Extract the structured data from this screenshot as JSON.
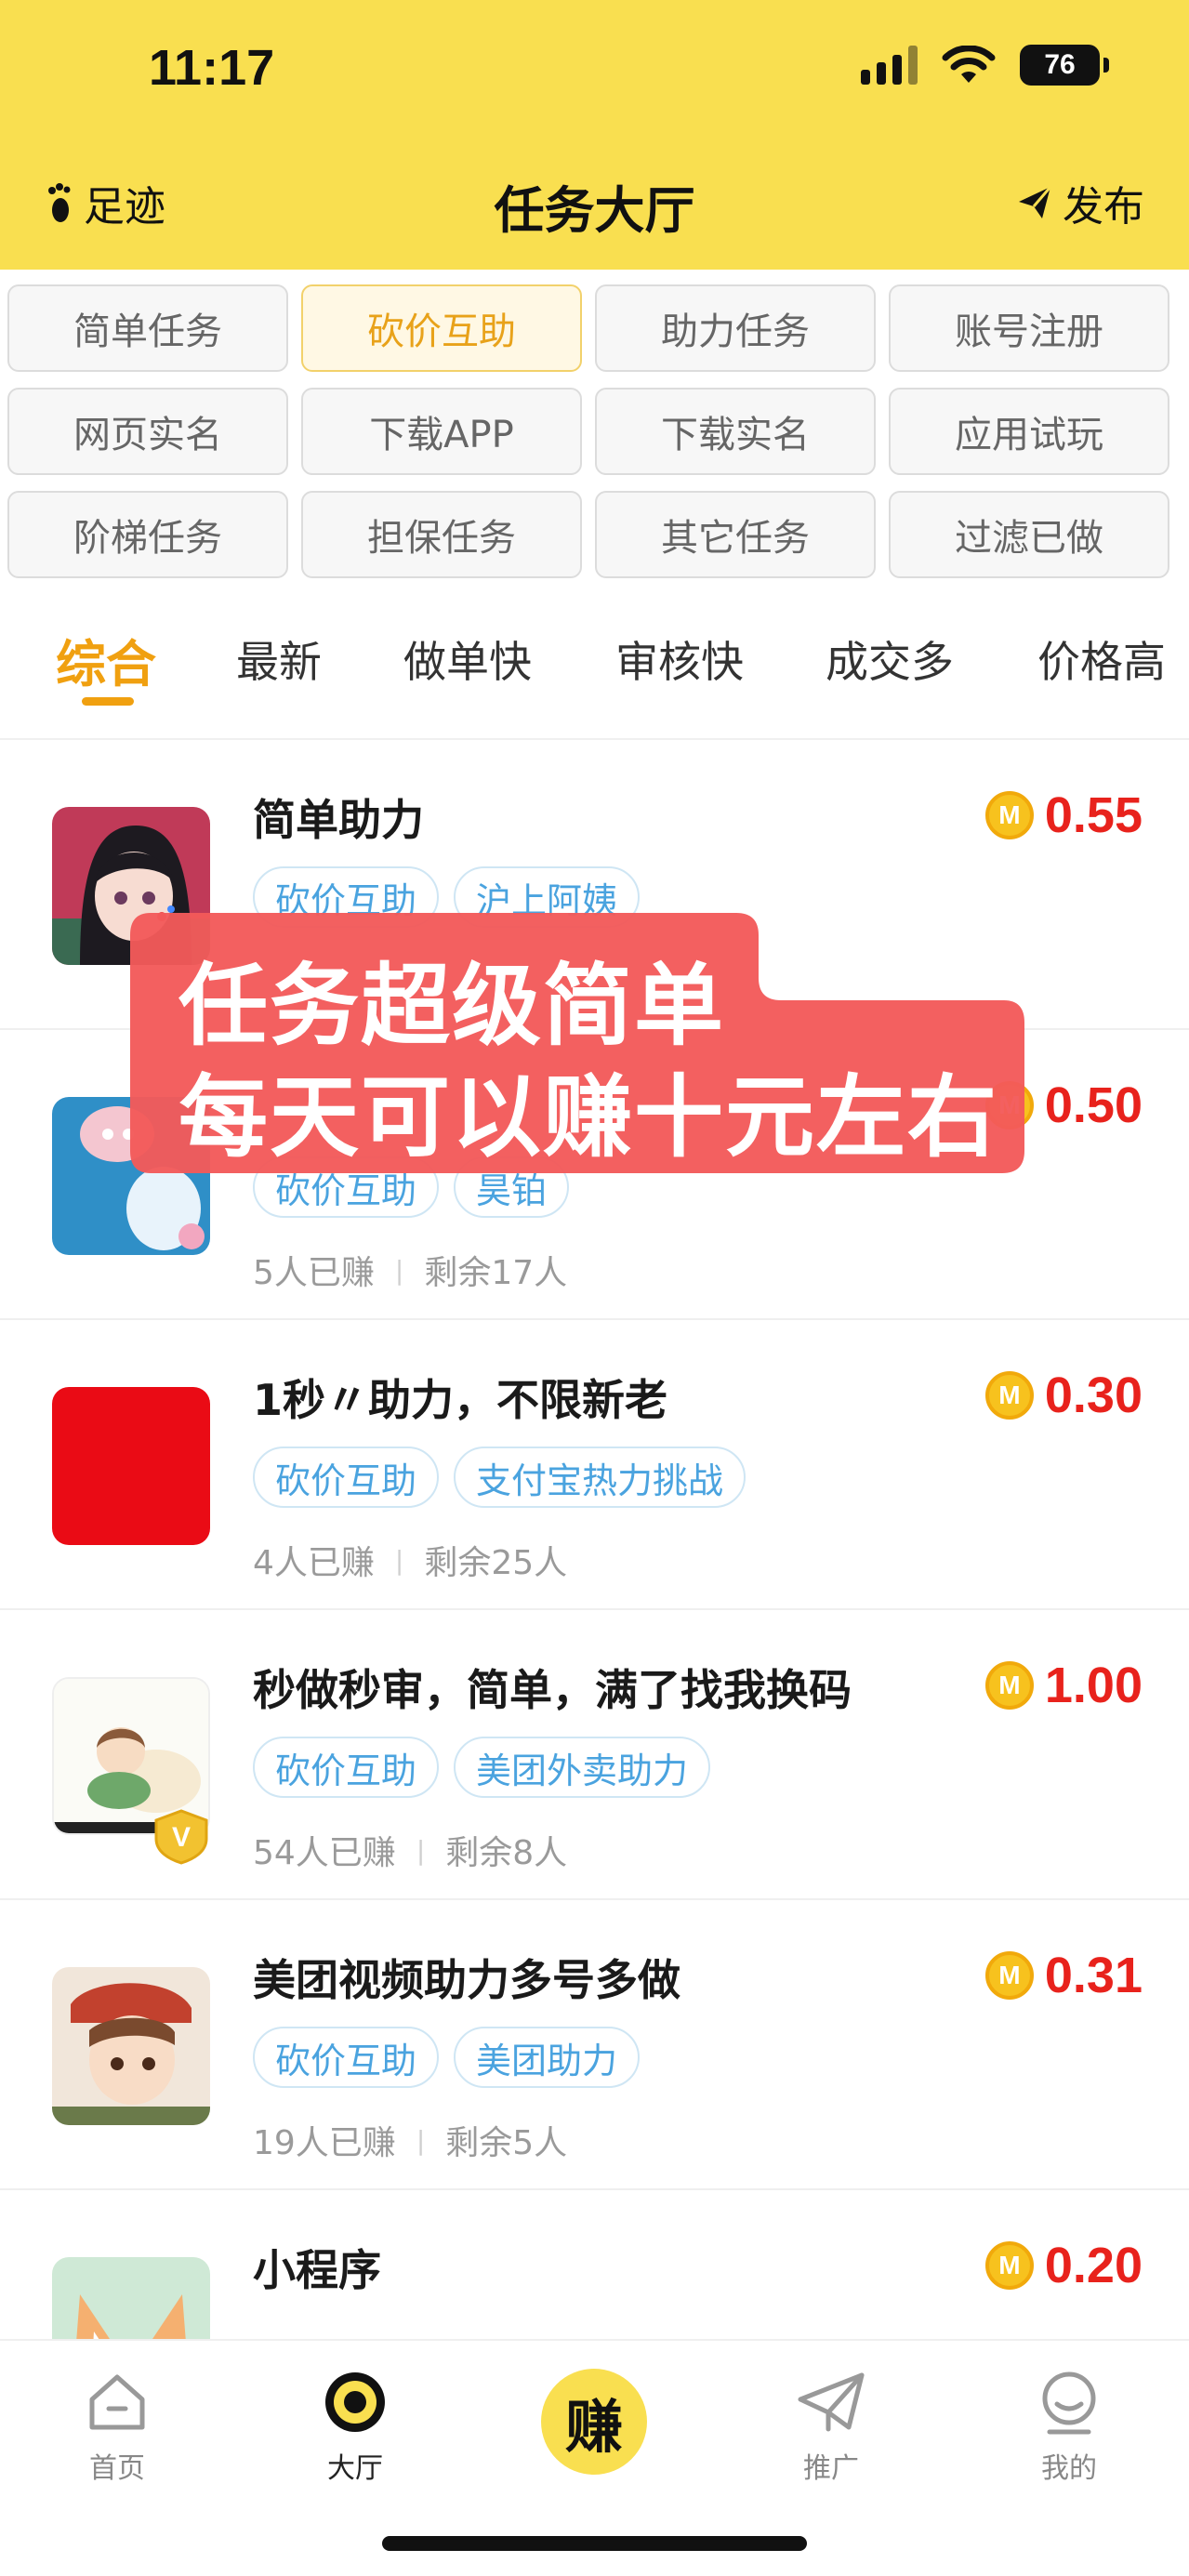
{
  "status_bar": {
    "time": "11:17",
    "battery": "76"
  },
  "nav": {
    "left_label": "足迹",
    "title": "任务大厅",
    "right_label": "发布"
  },
  "categories": [
    {
      "label": "简单任务"
    },
    {
      "label": "砍价互助"
    },
    {
      "label": "助力任务"
    },
    {
      "label": "账号注册"
    },
    {
      "label": "网页实名"
    },
    {
      "label": "下载APP"
    },
    {
      "label": "下载实名"
    },
    {
      "label": "应用试玩"
    },
    {
      "label": "阶梯任务"
    },
    {
      "label": "担保任务"
    },
    {
      "label": "其它任务"
    },
    {
      "label": "过滤已做"
    }
  ],
  "selected_category": "砍价互助",
  "sort_tabs": [
    {
      "label": "综合"
    },
    {
      "label": "最新"
    },
    {
      "label": "做单快"
    },
    {
      "label": "审核快"
    },
    {
      "label": "成交多"
    },
    {
      "label": "价格高"
    }
  ],
  "selected_sort": "综合",
  "tasks": [
    {
      "title": "简单助力",
      "tags": [
        "砍价互助",
        "沪上阿姨"
      ],
      "earned": "",
      "remaining": "",
      "price": "0.55",
      "thumb": "anime-girl-avatar"
    },
    {
      "title": "",
      "tags": [
        "砍价互助",
        "昊铂"
      ],
      "earned": "5人已赚",
      "remaining": "剩余17人",
      "price": "0.50",
      "thumb": "toy-avatar"
    },
    {
      "title": "1秒〃助力，不限新老",
      "tags": [
        "砍价互助",
        "支付宝热力挑战"
      ],
      "earned": "4人已赚",
      "remaining": "剩余25人",
      "price": "0.30",
      "thumb": "red-square-avatar"
    },
    {
      "title": "秒做秒审，简单，满了找我换码",
      "tags": [
        "砍价互助",
        "美团外卖助力"
      ],
      "earned": "54人已赚",
      "remaining": "剩余8人",
      "price": "1.00",
      "thumb": "sleeping-kid-avatar"
    },
    {
      "title": "美团视频助力多号多做",
      "tags": [
        "砍价互助",
        "美团助力"
      ],
      "earned": "19人已赚",
      "remaining": "剩余5人",
      "price": "0.31",
      "thumb": "saluting-boy-avatar"
    },
    {
      "title": "小程序",
      "tags": [],
      "earned": "",
      "remaining": "",
      "price": "0.20",
      "thumb": "cartoon-animal-avatar"
    }
  ],
  "coin_letter": "M",
  "vip_letter": "V",
  "promo": {
    "line1": "任务超级简单",
    "line2": "每天可以赚十元左右"
  },
  "tabbar": [
    {
      "label": "首页",
      "icon": "home-icon"
    },
    {
      "label": "大厅",
      "icon": "hall-icon"
    },
    {
      "label": "赚",
      "icon": "earn-icon"
    },
    {
      "label": "推广",
      "icon": "paper-plane-icon"
    },
    {
      "label": "我的",
      "icon": "profile-icon"
    }
  ],
  "colors": {
    "header_yellow": "#f9df50",
    "accent_orange": "#f0a010",
    "price_red": "#e8221c",
    "tag_blue": "#4aa3df",
    "promo_red": "#f2595a"
  }
}
